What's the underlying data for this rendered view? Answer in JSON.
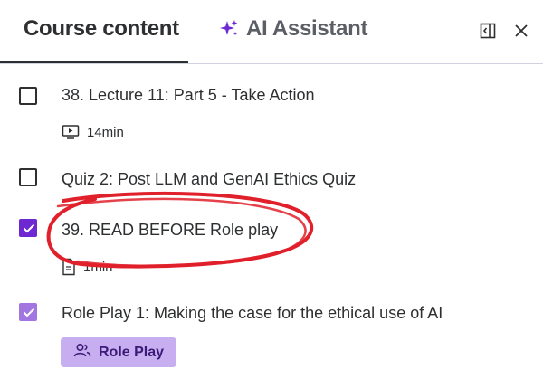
{
  "header": {
    "course_tab_label": "Course content",
    "ai_tab_label": "AI Assistant",
    "ai_tab_icon": "sparkle-icon",
    "panel_toggle_icon": "panel-toggle-icon",
    "close_icon": "close-icon",
    "accent_color": "#6d28d2"
  },
  "items": [
    {
      "title": "38. Lecture 11: Part 5 - Take Action",
      "checked": false,
      "meta_icon": "video-icon",
      "meta_text": "14min"
    },
    {
      "title": "Quiz 2: Post LLM and GenAI Ethics Quiz",
      "checked": false
    },
    {
      "title": "39. READ BEFORE Role play",
      "checked": true,
      "meta_icon": "document-icon",
      "meta_text": "1min",
      "annotation": "red-hand-drawn-circle"
    },
    {
      "title": "Role Play 1: Making the case for the ethical use of AI",
      "checked": true,
      "button_icon": "users-icon",
      "button_label": "Role Play"
    }
  ],
  "colors": {
    "checkbox_checked": "#6d28d2",
    "checkbox_checked_light": "#a276e0",
    "role_play_bg": "#c7aef0",
    "annotation_red": "#e0202a"
  }
}
